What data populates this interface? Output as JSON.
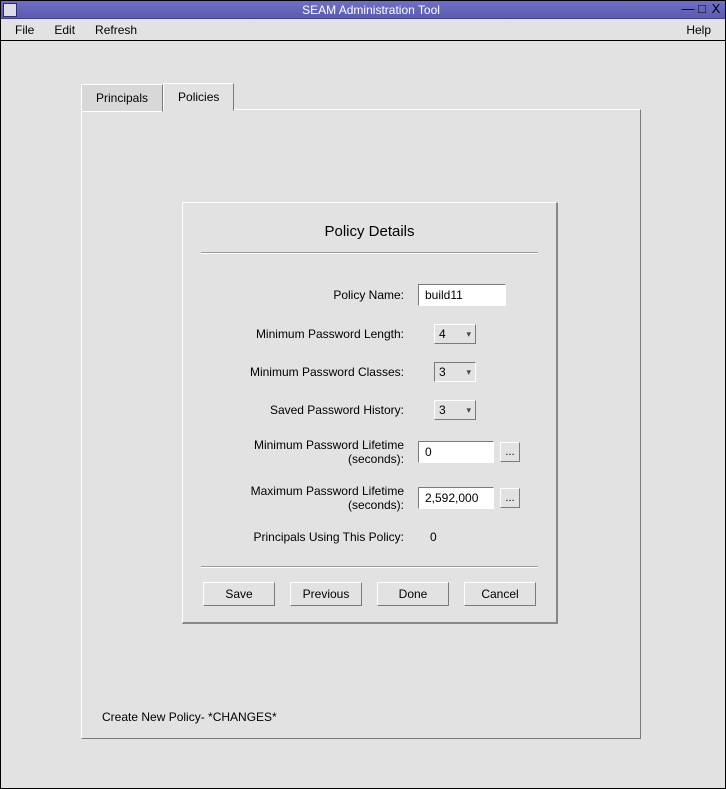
{
  "window": {
    "title": "SEAM Administration Tool"
  },
  "menu": {
    "file": "File",
    "edit": "Edit",
    "refresh": "Refresh",
    "help": "Help"
  },
  "tabs": {
    "principals": "Principals",
    "policies": "Policies"
  },
  "details": {
    "title": "Policy Details",
    "policy_name_label": "Policy Name:",
    "policy_name_value": "build11",
    "min_len_label": "Minimum Password Length:",
    "min_len_value": "4",
    "min_classes_label": "Minimum Password Classes:",
    "min_classes_value": "3",
    "history_label": "Saved Password History:",
    "history_value": "3",
    "min_life_label": "Minimum Password Lifetime (seconds):",
    "min_life_value": "0",
    "max_life_label": "Maximum Password Lifetime (seconds):",
    "max_life_value": "2,592,000",
    "using_label": "Principals Using This Policy:",
    "using_value": "0",
    "ellipsis": "..."
  },
  "buttons": {
    "save": "Save",
    "previous": "Previous",
    "done": "Done",
    "cancel": "Cancel"
  },
  "status": "Create New Policy- *CHANGES*"
}
